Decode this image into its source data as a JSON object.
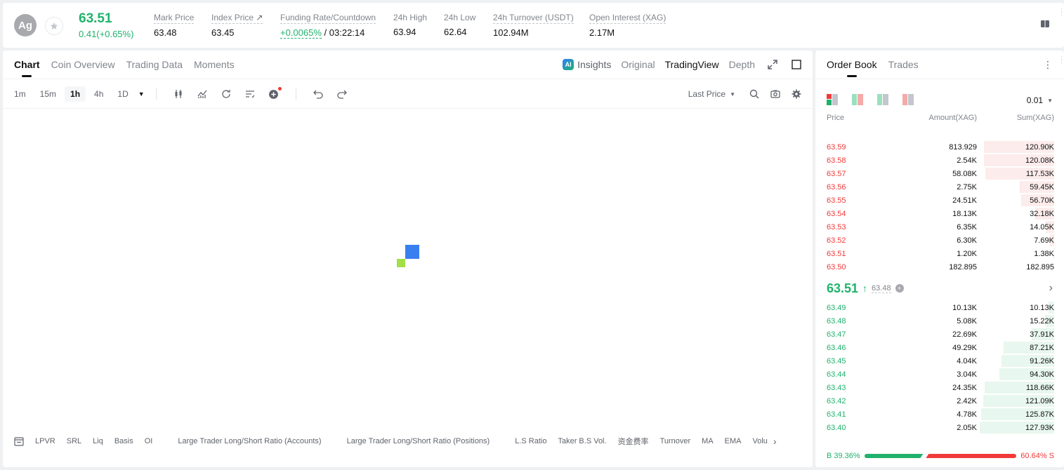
{
  "ticker": {
    "symbol_abbr": "Ag",
    "last_price": "63.51",
    "change": "0.41(+0.65%)",
    "mark_price_label": "Mark Price",
    "mark_price": "63.48",
    "index_price_label": "Index Price",
    "index_price": "63.45",
    "funding_label": "Funding Rate/Countdown",
    "funding_rate": "+0.0065%",
    "countdown": "/ 03:22:14",
    "high_label": "24h High",
    "high": "63.94",
    "low_label": "24h Low",
    "low": "62.64",
    "turnover_label": "24h Turnover (USDT)",
    "turnover": "102.94M",
    "oi_label": "Open Interest (XAG)",
    "oi": "2.17M"
  },
  "chart_tabs": [
    "Chart",
    "Coin Overview",
    "Trading Data",
    "Moments"
  ],
  "view_tabs": {
    "insights": "Insights",
    "original": "Original",
    "tradingview": "TradingView",
    "depth": "Depth"
  },
  "timeframes": [
    "1m",
    "15m",
    "1h",
    "4h",
    "1D"
  ],
  "price_type": "Last Price",
  "indicators": [
    "LPVR",
    "SRL",
    "Liq",
    "Basis",
    "OI",
    "Large Trader Long/Short Ratio (Accounts)",
    "Large Trader Long/Short Ratio (Positions)",
    "L.S Ratio",
    "Taker B.S Vol.",
    "资金费率",
    "Turnover",
    "MA",
    "EMA",
    "Volu"
  ],
  "orderbook": {
    "tabs": [
      "Order Book",
      "Trades"
    ],
    "precision": "0.01",
    "headers": {
      "price": "Price",
      "amount": "Amount(XAG)",
      "sum": "Sum(XAG)"
    },
    "asks": [
      {
        "price": "63.59",
        "amount": "813.929",
        "sum": "120.90K",
        "depth": 0.94
      },
      {
        "price": "63.58",
        "amount": "2.54K",
        "sum": "120.08K",
        "depth": 0.94
      },
      {
        "price": "63.57",
        "amount": "58.08K",
        "sum": "117.53K",
        "depth": 0.92
      },
      {
        "price": "63.56",
        "amount": "2.75K",
        "sum": "59.45K",
        "depth": 0.46
      },
      {
        "price": "63.55",
        "amount": "24.51K",
        "sum": "56.70K",
        "depth": 0.44
      },
      {
        "price": "63.54",
        "amount": "18.13K",
        "sum": "32.18K",
        "depth": 0.25
      },
      {
        "price": "63.53",
        "amount": "6.35K",
        "sum": "14.05K",
        "depth": 0.11
      },
      {
        "price": "63.52",
        "amount": "6.30K",
        "sum": "7.69K",
        "depth": 0.06
      },
      {
        "price": "63.51",
        "amount": "1.20K",
        "sum": "1.38K",
        "depth": 0.01
      },
      {
        "price": "63.50",
        "amount": "182.895",
        "sum": "182.895",
        "depth": 0.0
      }
    ],
    "mid_price": "63.51",
    "mid_arrow": "↑",
    "mark_price": "63.48",
    "bids": [
      {
        "price": "63.49",
        "amount": "10.13K",
        "sum": "10.13K",
        "depth": 0.08
      },
      {
        "price": "63.48",
        "amount": "5.08K",
        "sum": "15.22K",
        "depth": 0.12
      },
      {
        "price": "63.47",
        "amount": "22.69K",
        "sum": "37.91K",
        "depth": 0.3
      },
      {
        "price": "63.46",
        "amount": "49.29K",
        "sum": "87.21K",
        "depth": 0.68
      },
      {
        "price": "63.45",
        "amount": "4.04K",
        "sum": "91.26K",
        "depth": 0.71
      },
      {
        "price": "63.44",
        "amount": "3.04K",
        "sum": "94.30K",
        "depth": 0.74
      },
      {
        "price": "63.43",
        "amount": "24.35K",
        "sum": "118.66K",
        "depth": 0.93
      },
      {
        "price": "63.42",
        "amount": "2.42K",
        "sum": "121.09K",
        "depth": 0.95
      },
      {
        "price": "63.41",
        "amount": "4.78K",
        "sum": "125.87K",
        "depth": 0.98
      },
      {
        "price": "63.40",
        "amount": "2.05K",
        "sum": "127.93K",
        "depth": 1.0
      }
    ],
    "buy_ratio_label": "B 39.36%",
    "sell_ratio_label": "60.64% S",
    "buy_ratio": 39.36,
    "sell_ratio": 60.64
  },
  "colors": {
    "up": "#20b26c",
    "down": "#f23939",
    "text": "#121212",
    "muted": "#81858c"
  }
}
